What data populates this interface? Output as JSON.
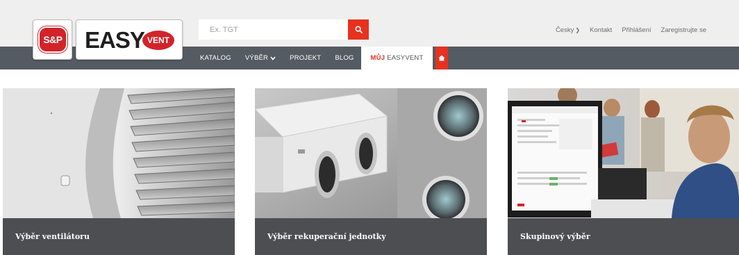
{
  "logo": {
    "sp_text": "S&P",
    "easy_text": "EASY",
    "vent_text": "VENT"
  },
  "search": {
    "placeholder": "Ex. TGT",
    "button_icon": "search-icon"
  },
  "top_links": {
    "language": "Česky",
    "contact": "Kontakt",
    "login": "Přihlášení",
    "register": "Zaregistrujte se"
  },
  "nav": {
    "katalog": "KATALOG",
    "vyber": "VÝBĚR",
    "projekt": "PROJEKT",
    "blog": "BLOG",
    "muj_bold": "MŮJ",
    "muj_rest": "EASYVENT",
    "home_icon": "home-icon"
  },
  "cards": [
    {
      "caption": "Výběr ventilátoru"
    },
    {
      "caption": "Výběr rekuperační jednotky"
    },
    {
      "caption": "Skupinový výběr"
    }
  ],
  "colors": {
    "accent": "#e8311e",
    "brand_red": "#d2232a",
    "nav_bg": "#555b62",
    "header_bg": "#efefef",
    "caption_bg": "#4c4e52"
  }
}
